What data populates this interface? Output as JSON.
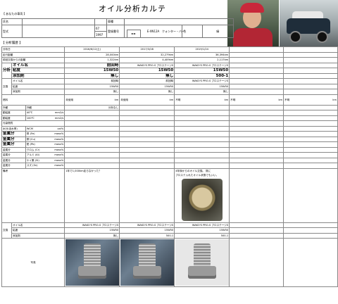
{
  "title": "オイル分析カルテ",
  "owner_tag": "【 あなたの車両 】",
  "info": {
    "row1": [
      "氏名",
      "",
      "",
      "",
      "",
      "",
      "",
      "",
      "",
      ""
    ],
    "label_name": "氏名",
    "label_car": "車種",
    "label_model": "型式",
    "model_year_top": "67",
    "model_year_bottom": "1997",
    "label_reg": "登録番号",
    "reg_value": "E-XN12A",
    "label_color": "色",
    "color_value": "緑",
    "label_shop": "ショップ",
    "shop_value": "クォンター・バー",
    "arrow": "►►"
  },
  "section_head": "【 分析履歴 】",
  "dates": [
    "2016/6/12(土)",
    "2017/3/28",
    "2019/1/24"
  ],
  "rows": {
    "analysis_date": "分析日",
    "odometer": "走行距離",
    "odo_vals": [
      "28,000km",
      "32,279km",
      "36,394km"
    ],
    "since_change": "前回交換からの距離",
    "since_vals": [
      "1,322km",
      "4,409km",
      "2,117km"
    ],
    "sample_side": "分析",
    "sample_side2": "検体",
    "oil_name_label": "オイル名",
    "oil_name_vals": [
      "前回時",
      "WAKO'S PRO-S プロステージS",
      "WAKO'S PRO-S プロステージS"
    ],
    "viscosity_label": "粘度",
    "viscosity_vals": [
      "15W50",
      "15W50",
      "15W50"
    ],
    "additive_label": "添加剤",
    "additive_vals": [
      "無し",
      "無し",
      "500-1"
    ],
    "change_side": "交換",
    "oil_label": "オイル名",
    "oil_vals": [
      "前回時",
      "前回時",
      "WAKO'S PRO-S プロステージS"
    ],
    "visc2_label": "粘度",
    "visc2_vals": [
      "15W50",
      "15W50",
      "15W50"
    ],
    "add2_label": "添加剤",
    "add2_vals": [
      "無し",
      "無し",
      "無し"
    ],
    "fuel_label": "燃料",
    "fuel_unit": "km",
    "fuel_sub": "未使用",
    "fuel_sub2": "不明",
    "appearance_label": "外観",
    "appearance_sub": "外観",
    "appearance_vals": [
      "分析なし",
      "",
      ""
    ],
    "visc40_label": "動粘度",
    "visc40_temp": "40℃",
    "visc_unit": "mm2/s",
    "visc100_label": "動粘度",
    "visc100_temp": "100℃",
    "contam_label": "汚染物質",
    "water_label": "水分(含水率)",
    "water_unit": "vol%",
    "water_code": "WCM",
    "metal1_label": "金属分",
    "metal1_sub": "鉄 (Fe)",
    "metal2_label": "金属分",
    "metal2_sub": "銅 (Cu)",
    "metal3_label": "金属分",
    "metal3_sub": "鉛 (Pb)",
    "metal4_label": "金属分",
    "metal4_sub": "クロム (Cr)",
    "metal5_label": "金属分",
    "metal5_sub": "アルミ (Al)",
    "metal6_label": "金属分",
    "metal6_sub": "ケイ素 (Si)",
    "metal7_label": "金属分",
    "metal7_sub": "スズ (Sn)",
    "ppm_unit": "mass%",
    "remarks_label": "備考",
    "remarks_col1": "1年で1,000km走らなかった？",
    "remarks_col3_a": "4年後からのオイル交換。 既に",
    "remarks_col3_b": "プロステ入れたオイル状態でもいい。",
    "bottom_side": "交換",
    "bottom_oil": "オイル名",
    "bottom_oil_vals": [
      "WAKO'S PRO-S プロステージS",
      "WAKO'S PRO-S プロステージS",
      "WAKO'S PRO-S プロステージS"
    ],
    "bottom_visc": "粘度",
    "bottom_visc_vals": [
      "15W50",
      "15W50",
      "15W50"
    ],
    "bottom_add": "添加剤",
    "bottom_add_vals": [
      "無し",
      "500-1",
      "500-1"
    ],
    "photo_label": "写真"
  },
  "icons": {
    "person_photo": "driver-photo-icon",
    "car_photo": "car-photo-icon",
    "drain_plug": "drain-plug-photo-icon",
    "oil_sample": "oil-filter-photo-icon"
  }
}
